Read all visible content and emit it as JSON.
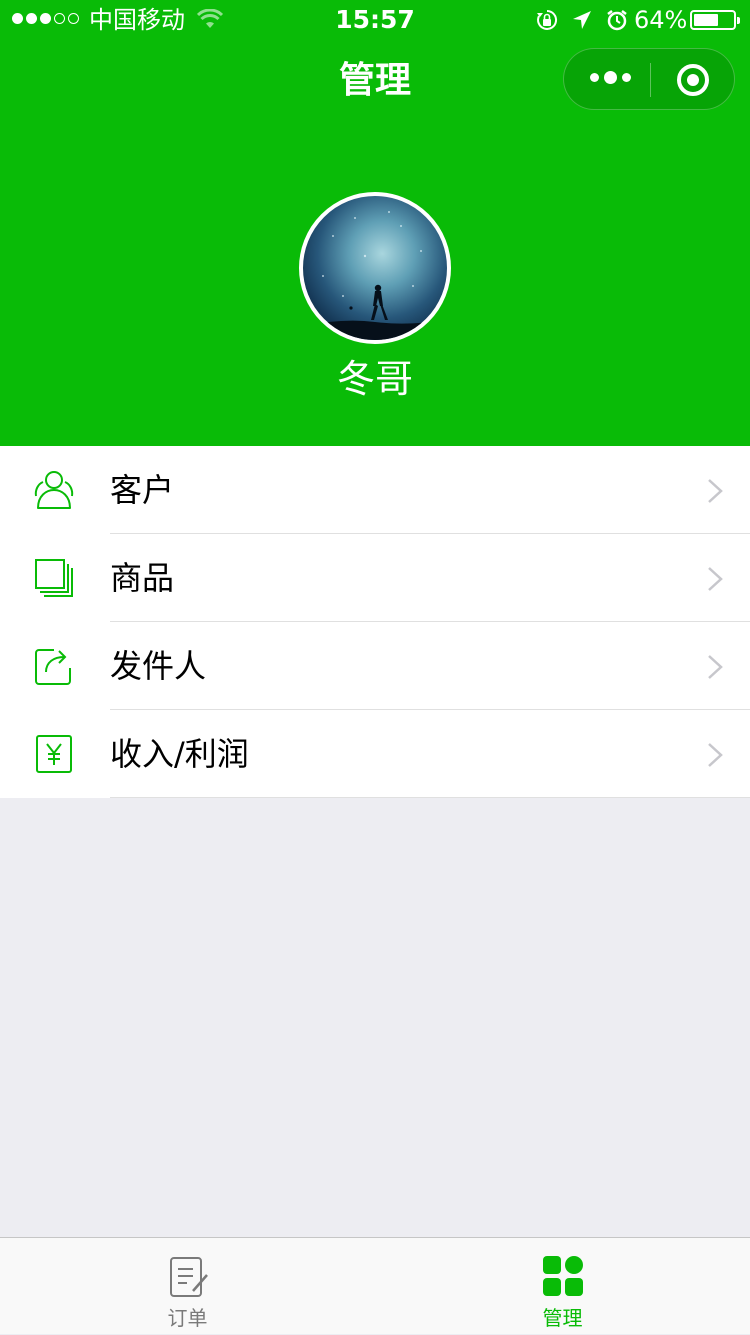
{
  "status_bar": {
    "carrier": "中国移动",
    "time": "15:57",
    "battery_percent": "64%",
    "battery_level": 0.64,
    "signal_bars": 3,
    "signal_bars_total": 5
  },
  "nav": {
    "title": "管理",
    "capsule_more_icon": "more-dots-icon",
    "capsule_close_icon": "target-icon"
  },
  "profile": {
    "username": "冬哥",
    "avatar_icon": "avatar-night-sky-image"
  },
  "menu": {
    "items": [
      {
        "label": "客户",
        "icon": "customers-icon"
      },
      {
        "label": "商品",
        "icon": "products-icon"
      },
      {
        "label": "发件人",
        "icon": "sender-icon"
      },
      {
        "label": "收入/利润",
        "icon": "income-icon"
      }
    ]
  },
  "tabbar": {
    "tabs": [
      {
        "label": "订单",
        "icon": "order-icon",
        "active": false
      },
      {
        "label": "管理",
        "icon": "manage-grid-icon",
        "active": true
      }
    ]
  },
  "colors": {
    "primary_green": "#09bb07",
    "page_background": "#ededf2",
    "tab_inactive": "#7a7a7a",
    "chevron": "#c7c7cc"
  }
}
